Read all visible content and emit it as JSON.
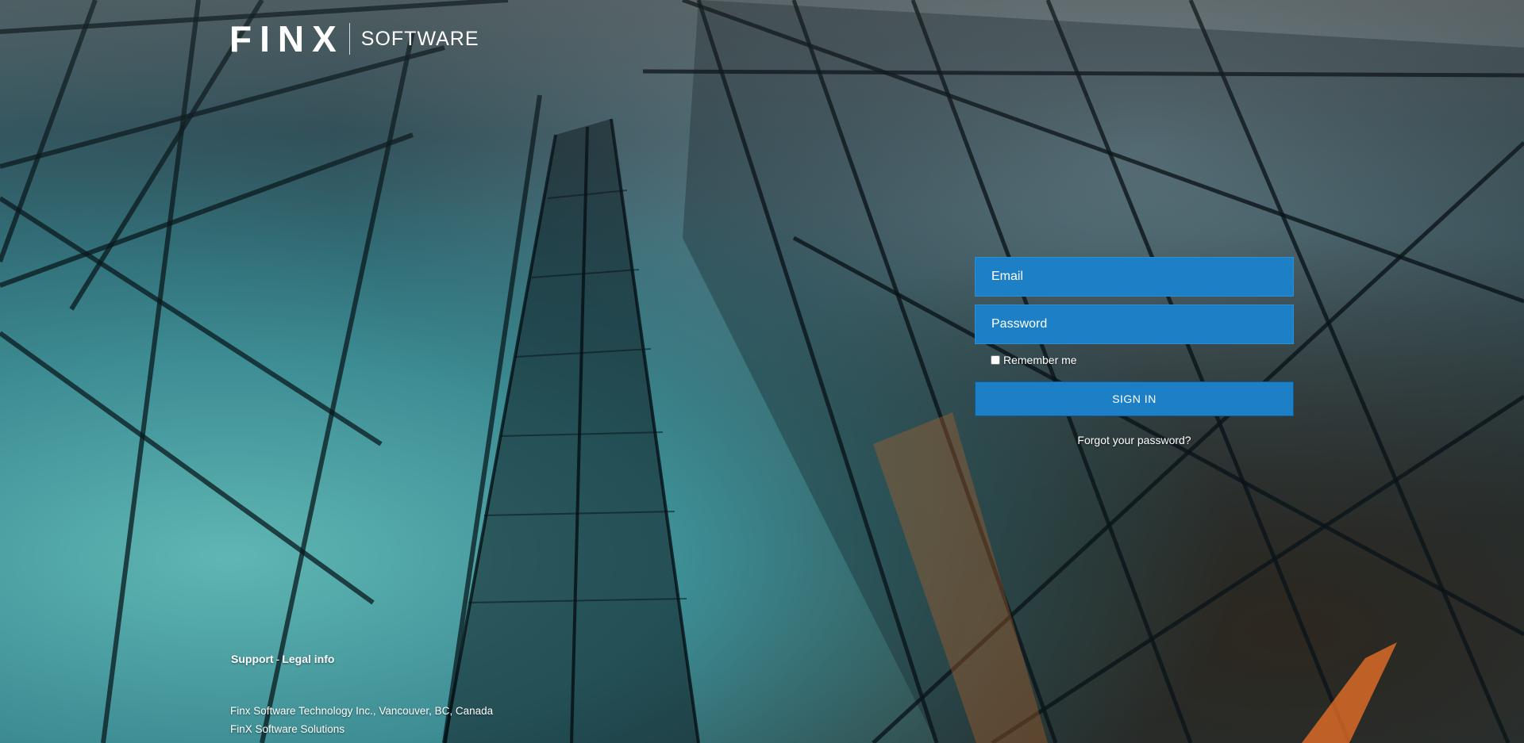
{
  "brand": {
    "logo_text": "FINX",
    "logo_sub": "SOFTWARE",
    "accent_color": "#2da1d8"
  },
  "login": {
    "email_placeholder": "Email",
    "password_placeholder": "Password",
    "remember_label": "Remember me",
    "signin_label": "SIGN IN",
    "forgot_label": "Forgot your password?",
    "field_color": "#1d7fc6"
  },
  "footer": {
    "support_label": "Support",
    "separator": "-",
    "legal_label": "Legal info",
    "company_line": "Finx Software Technology Inc., Vancouver, BC, Canada",
    "solutions_line": "FinX Software Solutions"
  }
}
